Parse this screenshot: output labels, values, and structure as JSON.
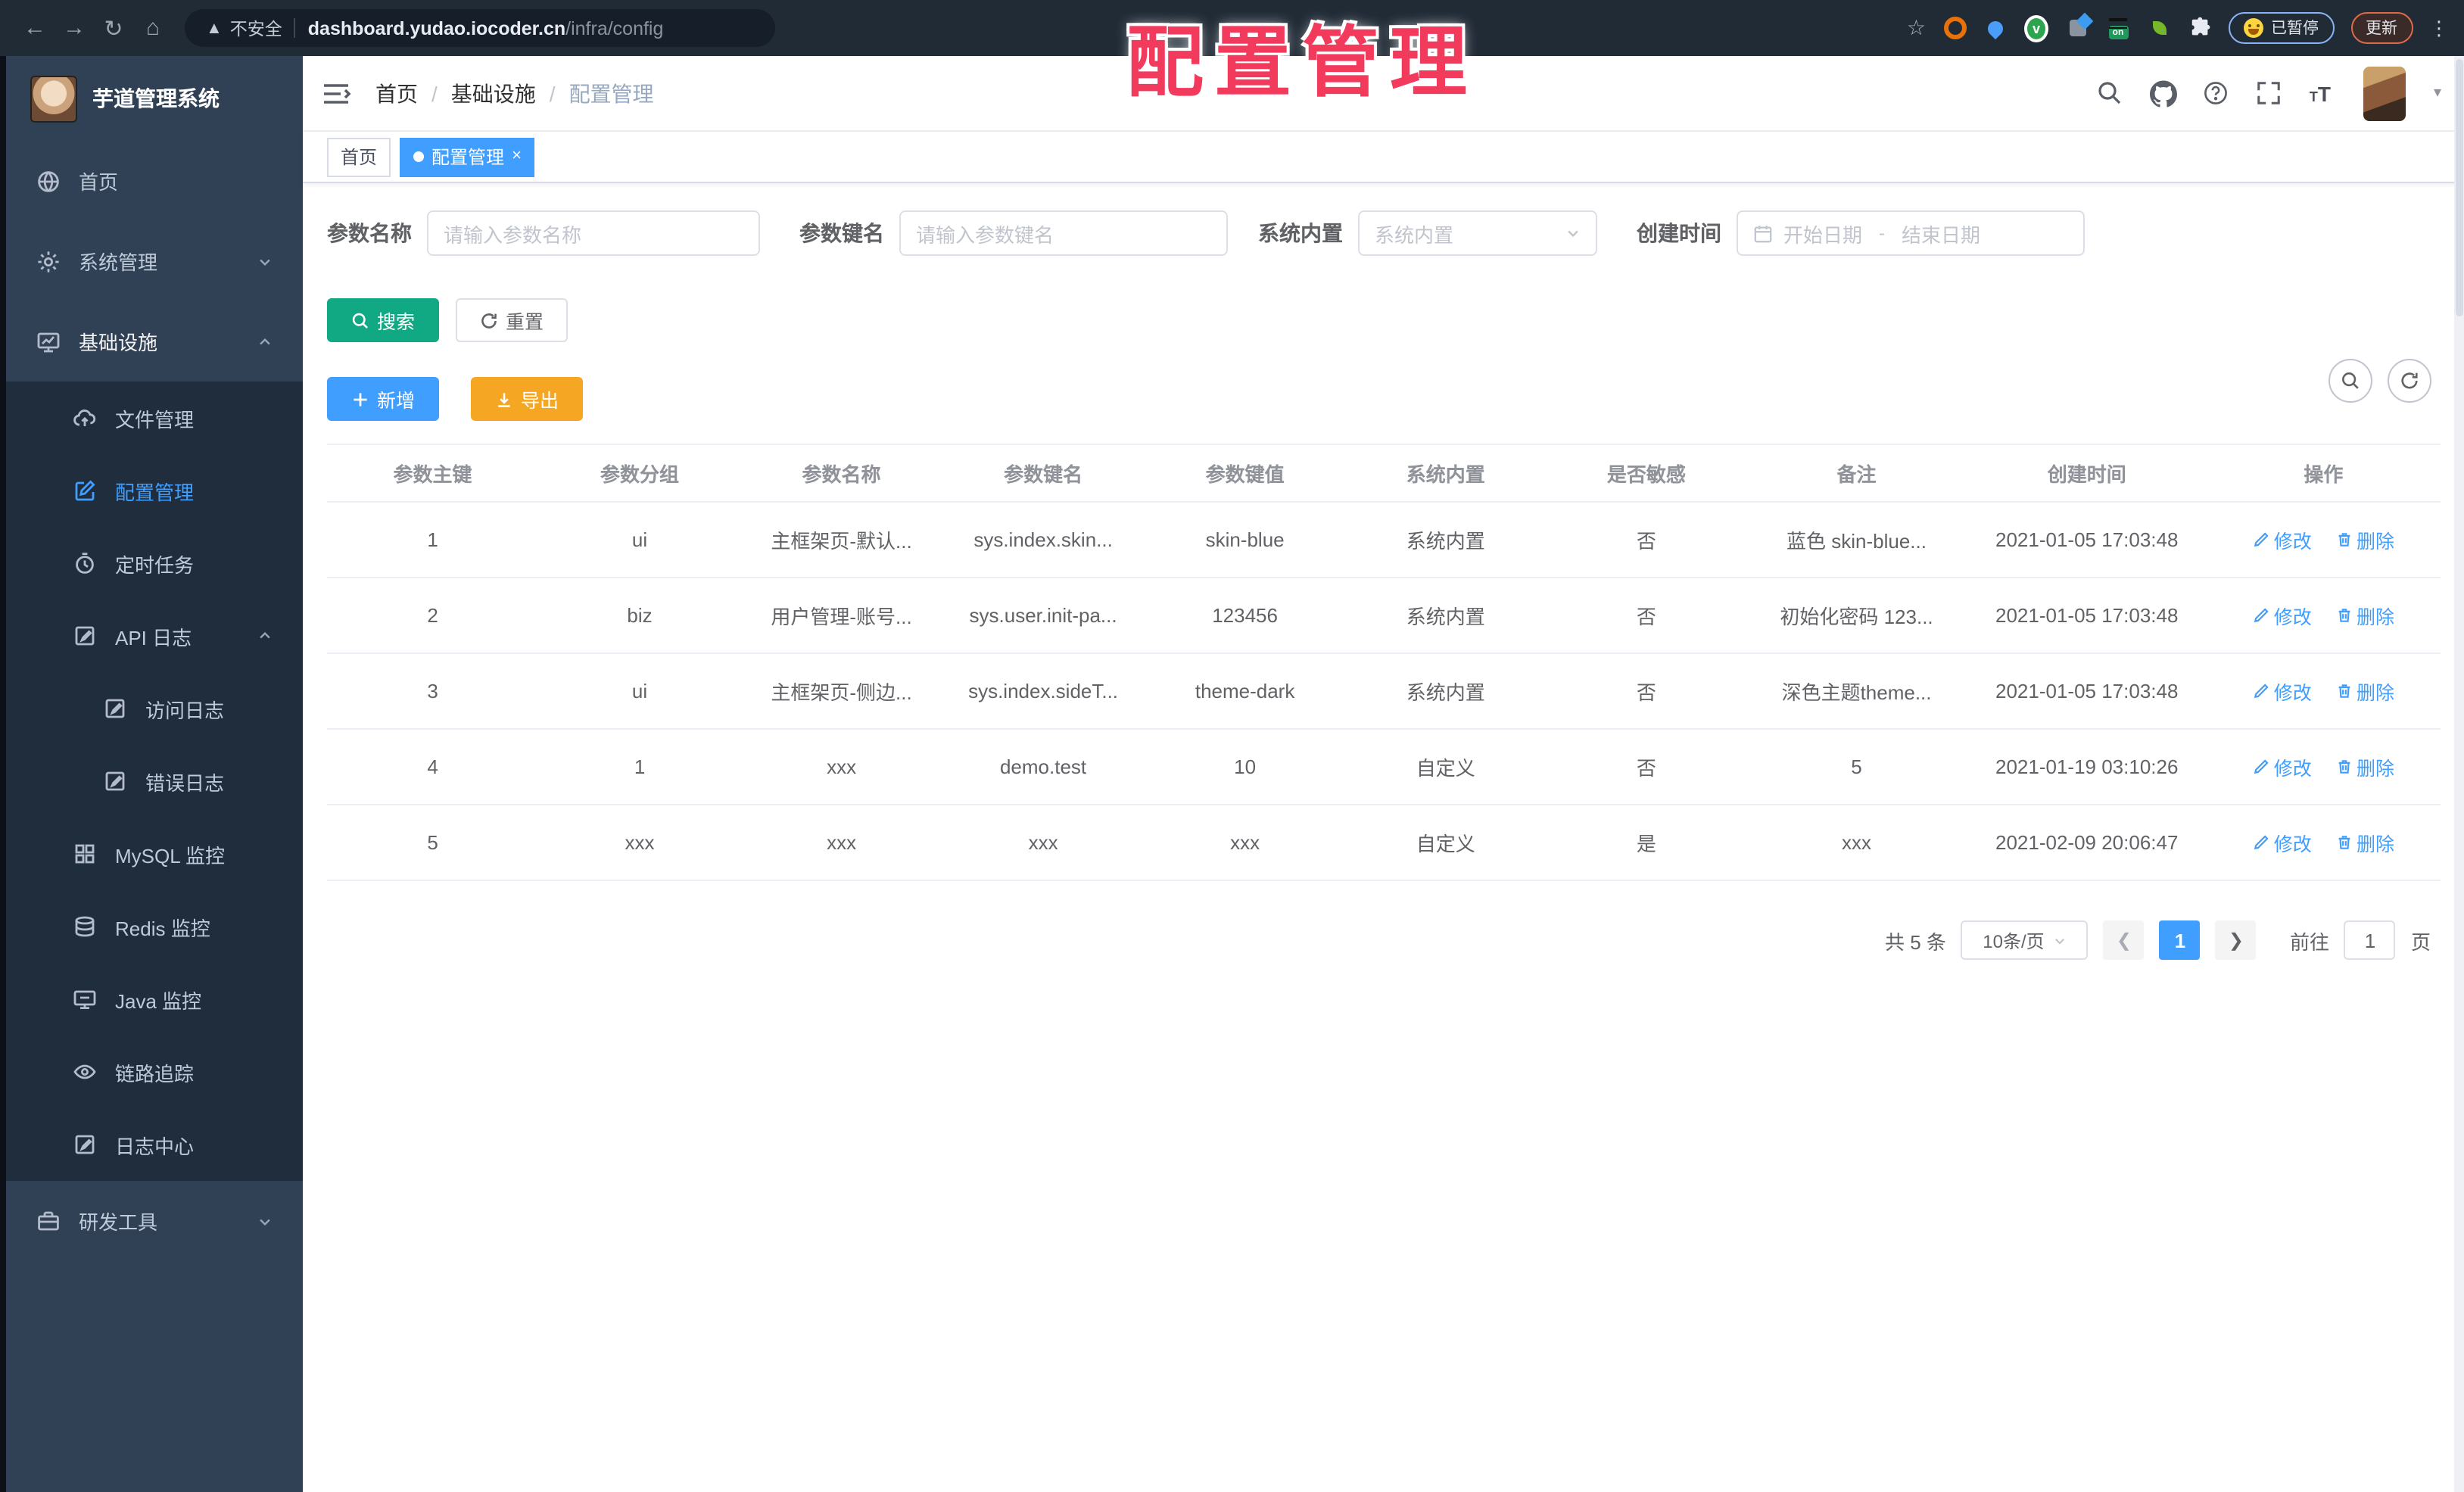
{
  "browser": {
    "security_label": "不安全",
    "url_host": "dashboard.yudao.iocoder.cn",
    "url_path": "/infra/config",
    "paused_badge": "已暂停",
    "update_button": "更新"
  },
  "overlay": {
    "title": "配置管理"
  },
  "sidebar": {
    "app_title": "芋道管理系统",
    "home": "首页",
    "system": "系统管理",
    "infra": "基础设施",
    "file": "文件管理",
    "config": "配置管理",
    "job": "定时任务",
    "api_log": "API 日志",
    "access_log": "访问日志",
    "error_log": "错误日志",
    "mysql": "MySQL 监控",
    "redis": "Redis 监控",
    "java": "Java 监控",
    "trace": "链路追踪",
    "log_center": "日志中心",
    "dev_tools": "研发工具"
  },
  "header": {
    "crumb_home": "首页",
    "sep": "/",
    "crumb_infra": "基础设施",
    "crumb_config": "配置管理"
  },
  "tags": {
    "tab_home": "首页",
    "tab_config": "配置管理",
    "close": "×"
  },
  "filters": {
    "param_name_label": "参数名称",
    "param_name_placeholder": "请输入参数名称",
    "param_key_label": "参数键名",
    "param_key_placeholder": "请输入参数键名",
    "builtin_label": "系统内置",
    "builtin_placeholder": "系统内置",
    "create_time_label": "创建时间",
    "date_start_placeholder": "开始日期",
    "date_separator": "-",
    "date_end_placeholder": "结束日期",
    "search_button": "搜索",
    "reset_button": "重置",
    "add_button": "新增",
    "export_button": "导出"
  },
  "table": {
    "headers": [
      "参数主键",
      "参数分组",
      "参数名称",
      "参数键名",
      "参数键值",
      "系统内置",
      "是否敏感",
      "备注",
      "创建时间",
      "操作"
    ],
    "edit_label": "修改",
    "delete_label": "删除",
    "rows": [
      {
        "id": "1",
        "group": "ui",
        "name": "主框架页-默认...",
        "key": "sys.index.skin...",
        "value": "skin-blue",
        "builtin": "系统内置",
        "sensitive": "否",
        "remark": "蓝色 skin-blue...",
        "created": "2021-01-05 17:03:48"
      },
      {
        "id": "2",
        "group": "biz",
        "name": "用户管理-账号...",
        "key": "sys.user.init-pa...",
        "value": "123456",
        "builtin": "系统内置",
        "sensitive": "否",
        "remark": "初始化密码 123...",
        "created": "2021-01-05 17:03:48"
      },
      {
        "id": "3",
        "group": "ui",
        "name": "主框架页-侧边...",
        "key": "sys.index.sideT...",
        "value": "theme-dark",
        "builtin": "系统内置",
        "sensitive": "否",
        "remark": "深色主题theme...",
        "created": "2021-01-05 17:03:48"
      },
      {
        "id": "4",
        "group": "1",
        "name": "xxx",
        "key": "demo.test",
        "value": "10",
        "builtin": "自定义",
        "sensitive": "否",
        "remark": "5",
        "created": "2021-01-19 03:10:26"
      },
      {
        "id": "5",
        "group": "xxx",
        "name": "xxx",
        "key": "xxx",
        "value": "xxx",
        "builtin": "自定义",
        "sensitive": "是",
        "remark": "xxx",
        "created": "2021-02-09 20:06:47"
      }
    ]
  },
  "pagination": {
    "total_label": "共 5 条",
    "page_size": "10条/页",
    "current_page": "1",
    "goto_label": "前往",
    "goto_value": "1",
    "page_unit": "页"
  },
  "colors": {
    "accent_blue": "#409eff",
    "teal": "#11a983",
    "orange": "#f5a623",
    "sidebar_bg": "#304156",
    "submenu_bg": "#1f2d3d",
    "overlay_red": "#f23a5c"
  }
}
